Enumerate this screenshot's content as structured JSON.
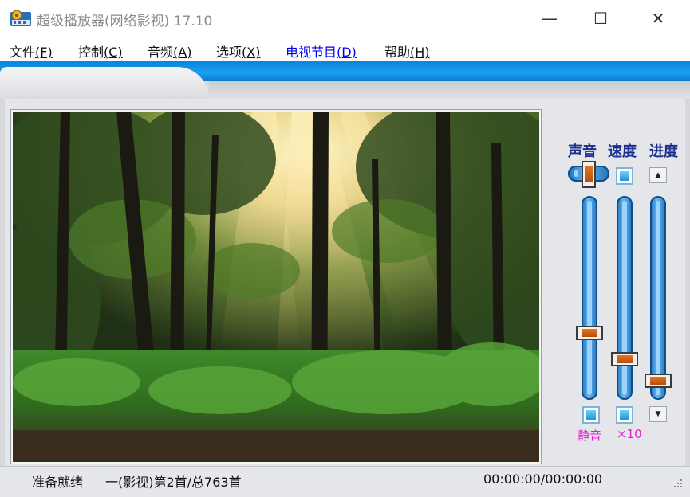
{
  "window": {
    "title": "超级播放器(网络影视) 17.10",
    "minimize_glyph": "—",
    "maximize_glyph": "☐",
    "close_glyph": "✕"
  },
  "menu": {
    "items": [
      {
        "label": "文件",
        "key": "(F)"
      },
      {
        "label": "控制",
        "key": "(C)"
      },
      {
        "label": "音频",
        "key": "(A)"
      },
      {
        "label": "选项",
        "key": "(X)"
      },
      {
        "label": "电视节目",
        "key": "(D)"
      },
      {
        "label": "帮助",
        "key": "(H)"
      }
    ]
  },
  "controls": {
    "volume_label": "声音",
    "speed_label": "速度",
    "progress_label": "进度",
    "mute_label": "静音",
    "speed_multiplier_label": "×10",
    "volume_level": 0.31,
    "speed_level": 0.17,
    "progress_level": 0.06
  },
  "status": {
    "state": "准备就绪",
    "track_info": "一(影视)第2首/总763首",
    "time": "00:00:00/00:00:00"
  },
  "colors": {
    "accent_blue": "#1a9ff0",
    "label_blue": "#1d2f8f",
    "magenta": "#e020d8",
    "active_menu": "#0000ee"
  }
}
